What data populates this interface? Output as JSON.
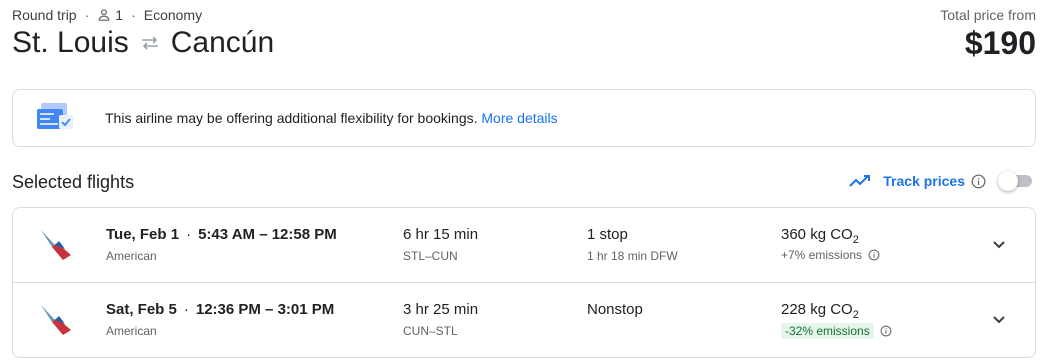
{
  "header": {
    "trip_type": "Round trip",
    "passengers": "1",
    "cabin": "Economy",
    "origin": "St. Louis",
    "destination": "Cancún",
    "total_label": "Total price from",
    "total_price": "$190"
  },
  "banner": {
    "message": "This airline may be offering additional flexibility for bookings.",
    "link": "More details"
  },
  "selected": {
    "title": "Selected flights",
    "track_label": "Track prices",
    "track_enabled": false
  },
  "flights": [
    {
      "date": "Tue, Feb 1",
      "times": "5:43 AM – 12:58 PM",
      "airline": "American",
      "duration": "6 hr 15 min",
      "airports": "STL–CUN",
      "stops": "1 stop",
      "layover": "1 hr 18 min DFW",
      "co2_value": "360 kg CO",
      "co2_sub": "2",
      "emissions": "+7% emissions",
      "emissions_good": false
    },
    {
      "date": "Sat, Feb 5",
      "times": "12:36 PM – 3:01 PM",
      "airline": "American",
      "duration": "3 hr 25 min",
      "airports": "CUN–STL",
      "stops": "Nonstop",
      "layover": "",
      "co2_value": "228 kg CO",
      "co2_sub": "2",
      "emissions": "-32% emissions",
      "emissions_good": true
    }
  ],
  "icons": {
    "person": "person-icon",
    "swap": "swap-arrows-icon",
    "banner": "flexible-booking-illustration",
    "trend": "trending-up-icon",
    "info": "info-icon",
    "expand": "chevron-down-icon",
    "airline_logo": "american-airlines-logo"
  },
  "colors": {
    "accent": "#1a73e8",
    "border": "#dadce0",
    "good_bg": "#e6f4ea",
    "good_text": "#137333"
  }
}
